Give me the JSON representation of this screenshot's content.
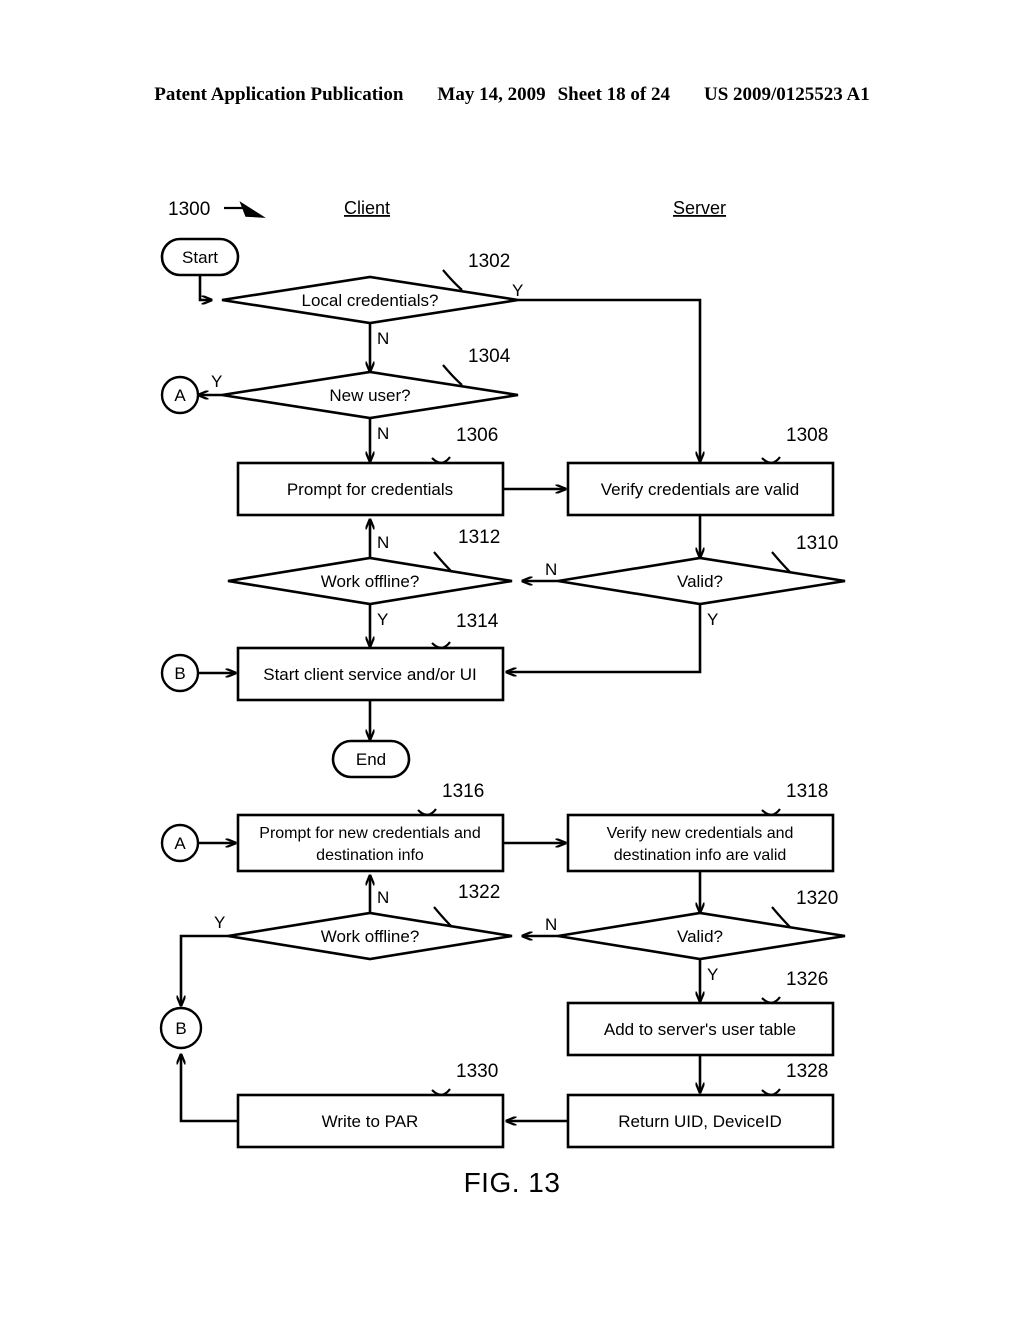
{
  "header": {
    "publication": "Patent Application Publication",
    "date": "May 14, 2009",
    "sheet": "Sheet 18 of 24",
    "pub_number": "US 2009/0125523 A1"
  },
  "figure": {
    "caption": "FIG. 13",
    "diagram_number": "1300",
    "lanes": [
      {
        "id": "client",
        "label": "Client"
      },
      {
        "id": "server",
        "label": "Server"
      }
    ]
  },
  "chart_data": {
    "type": "diagram",
    "title": "FIG. 13",
    "diagram_kind": "flowchart",
    "diagram_ref": "1300",
    "lanes": [
      "Client",
      "Server"
    ],
    "nodes": [
      {
        "ref": "",
        "id": "start",
        "shape": "terminator",
        "label": "Start",
        "lane": "client"
      },
      {
        "ref": "1302",
        "id": "local_credentials",
        "shape": "decision",
        "label": "Local credentials?",
        "lane": "client"
      },
      {
        "ref": "1304",
        "id": "new_user",
        "shape": "decision",
        "label": "New user?",
        "lane": "client"
      },
      {
        "ref": "1306",
        "id": "prompt_credentials",
        "shape": "process",
        "label": "Prompt for credentials",
        "lane": "client"
      },
      {
        "ref": "1308",
        "id": "verify_credentials",
        "shape": "process",
        "label": "Verify credentials are valid",
        "lane": "server"
      },
      {
        "ref": "1310",
        "id": "valid_1",
        "shape": "decision",
        "label": "Valid?",
        "lane": "server"
      },
      {
        "ref": "1312",
        "id": "work_offline_1",
        "shape": "decision",
        "label": "Work offline?",
        "lane": "client"
      },
      {
        "ref": "1314",
        "id": "start_client_service",
        "shape": "process",
        "label": "Start client service and/or UI",
        "lane": "client"
      },
      {
        "ref": "",
        "id": "end",
        "shape": "terminator",
        "label": "End",
        "lane": "client"
      },
      {
        "ref": "1316",
        "id": "prompt_new_credentials",
        "shape": "process",
        "label": "Prompt for new credentials and destination info",
        "label_line1": "Prompt for new credentials and",
        "label_line2": "destination info",
        "lane": "client"
      },
      {
        "ref": "1318",
        "id": "verify_new_credentials",
        "shape": "process",
        "label": "Verify new credentials and destination info are valid",
        "label_line1": "Verify new credentials and",
        "label_line2": "destination info are valid",
        "lane": "server"
      },
      {
        "ref": "1320",
        "id": "valid_2",
        "shape": "decision",
        "label": "Valid?",
        "lane": "server"
      },
      {
        "ref": "1322",
        "id": "work_offline_2",
        "shape": "decision",
        "label": "Work offline?",
        "lane": "client"
      },
      {
        "ref": "1326",
        "id": "add_user_table",
        "shape": "process",
        "label": "Add to server's user table",
        "lane": "server"
      },
      {
        "ref": "1328",
        "id": "return_uid",
        "shape": "process",
        "label": "Return UID, DeviceID",
        "lane": "server"
      },
      {
        "ref": "1330",
        "id": "write_par",
        "shape": "process",
        "label": "Write to PAR",
        "lane": "client"
      },
      {
        "ref": "",
        "id": "conn_a_top",
        "shape": "connector",
        "label": "A",
        "lane": "client"
      },
      {
        "ref": "",
        "id": "conn_b_top",
        "shape": "connector",
        "label": "B",
        "lane": "client"
      },
      {
        "ref": "",
        "id": "conn_a_bottom",
        "shape": "connector",
        "label": "A",
        "lane": "client"
      },
      {
        "ref": "",
        "id": "conn_b_bottom",
        "shape": "connector",
        "label": "B",
        "lane": "client"
      }
    ],
    "edges": [
      {
        "from": "start",
        "to": "local_credentials",
        "label": ""
      },
      {
        "from": "local_credentials",
        "to": "verify_credentials",
        "label": "Y"
      },
      {
        "from": "local_credentials",
        "to": "new_user",
        "label": "N"
      },
      {
        "from": "new_user",
        "to": "conn_a_top",
        "label": "Y"
      },
      {
        "from": "new_user",
        "to": "prompt_credentials",
        "label": "N"
      },
      {
        "from": "prompt_credentials",
        "to": "verify_credentials",
        "label": ""
      },
      {
        "from": "verify_credentials",
        "to": "valid_1",
        "label": ""
      },
      {
        "from": "valid_1",
        "to": "work_offline_1",
        "label": "N"
      },
      {
        "from": "valid_1",
        "to": "start_client_service",
        "label": "Y"
      },
      {
        "from": "work_offline_1",
        "to": "prompt_credentials",
        "label": "N"
      },
      {
        "from": "work_offline_1",
        "to": "start_client_service",
        "label": "Y"
      },
      {
        "from": "conn_b_top",
        "to": "start_client_service",
        "label": ""
      },
      {
        "from": "start_client_service",
        "to": "end",
        "label": ""
      },
      {
        "from": "conn_a_bottom",
        "to": "prompt_new_credentials",
        "label": ""
      },
      {
        "from": "prompt_new_credentials",
        "to": "verify_new_credentials",
        "label": ""
      },
      {
        "from": "verify_new_credentials",
        "to": "valid_2",
        "label": ""
      },
      {
        "from": "valid_2",
        "to": "work_offline_2",
        "label": "N"
      },
      {
        "from": "valid_2",
        "to": "add_user_table",
        "label": "Y"
      },
      {
        "from": "work_offline_2",
        "to": "prompt_new_credentials",
        "label": "N"
      },
      {
        "from": "work_offline_2",
        "to": "conn_b_bottom",
        "label": "Y"
      },
      {
        "from": "add_user_table",
        "to": "return_uid",
        "label": ""
      },
      {
        "from": "return_uid",
        "to": "write_par",
        "label": ""
      },
      {
        "from": "write_par",
        "to": "conn_b_bottom",
        "label": ""
      }
    ]
  },
  "nodes": {
    "start": {
      "label": "Start"
    },
    "local_credentials": {
      "label": "Local credentials?",
      "ref": "1302"
    },
    "new_user": {
      "label": "New user?",
      "ref": "1304"
    },
    "prompt_credentials": {
      "label": "Prompt for credentials",
      "ref": "1306"
    },
    "verify_credentials": {
      "label": "Verify credentials are valid",
      "ref": "1308"
    },
    "valid_1": {
      "label": "Valid?",
      "ref": "1310"
    },
    "work_offline_1": {
      "label": "Work offline?",
      "ref": "1312"
    },
    "start_client_service": {
      "label": "Start client service and/or UI",
      "ref": "1314"
    },
    "end": {
      "label": "End"
    },
    "prompt_new_credentials": {
      "line1": "Prompt for new credentials and",
      "line2": "destination info",
      "ref": "1316"
    },
    "verify_new_credentials": {
      "line1": "Verify new credentials and",
      "line2": "destination info are valid",
      "ref": "1318"
    },
    "valid_2": {
      "label": "Valid?",
      "ref": "1320"
    },
    "work_offline_2": {
      "label": "Work offline?",
      "ref": "1322"
    },
    "add_user_table": {
      "label": "Add to server's user table",
      "ref": "1326"
    },
    "return_uid": {
      "label": "Return UID, DeviceID",
      "ref": "1328"
    },
    "write_par": {
      "label": "Write to PAR",
      "ref": "1330"
    },
    "conn_a_top": {
      "label": "A"
    },
    "conn_b_top": {
      "label": "B"
    },
    "conn_a_bottom": {
      "label": "A"
    },
    "conn_b_bottom": {
      "label": "B"
    }
  },
  "branches": {
    "y1302": "Y",
    "n1302": "N",
    "y1304": "Y",
    "n1304": "N",
    "n1310": "N",
    "y1310": "Y",
    "n1312": "N",
    "y1312": "Y",
    "n1320": "N",
    "y1320": "Y",
    "n1322": "N",
    "y1322": "Y"
  }
}
